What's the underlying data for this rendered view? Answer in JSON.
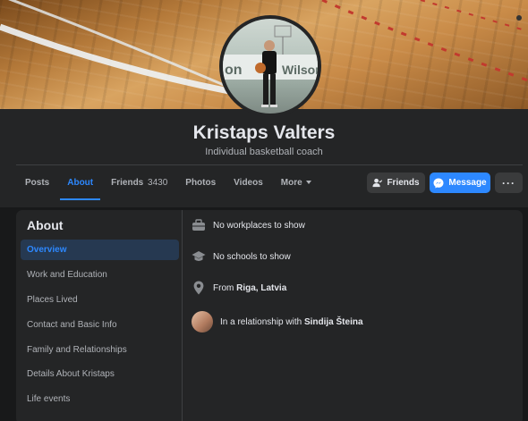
{
  "profile": {
    "name": "Kristaps Valters",
    "bio": "Individual basketball coach"
  },
  "cover": {
    "banner_text_left": "on",
    "banner_text_right": "Wilson"
  },
  "tabs": [
    {
      "label": "Posts",
      "active": false
    },
    {
      "label": "About",
      "active": true
    },
    {
      "label": "Friends",
      "count": "3430",
      "active": false
    },
    {
      "label": "Photos",
      "active": false
    },
    {
      "label": "Videos",
      "active": false
    },
    {
      "label": "More",
      "active": false
    }
  ],
  "actions": {
    "friends_label": "Friends",
    "message_label": "Message",
    "more_label": "···"
  },
  "about": {
    "title": "About",
    "menu": [
      {
        "label": "Overview",
        "active": true
      },
      {
        "label": "Work and Education",
        "active": false
      },
      {
        "label": "Places Lived",
        "active": false
      },
      {
        "label": "Contact and Basic Info",
        "active": false
      },
      {
        "label": "Family and Relationships",
        "active": false
      },
      {
        "label": "Details About Kristaps",
        "active": false
      },
      {
        "label": "Life events",
        "active": false
      }
    ],
    "overview": {
      "work": "No workplaces to show",
      "school": "No schools to show",
      "from_prefix": "From",
      "from_place": "Riga, Latvia",
      "relationship_prefix": "In a relationship with",
      "relationship_partner": "Sindija Šteina"
    }
  },
  "colors": {
    "accent": "#2d88ff",
    "background": "#18191a",
    "card": "#242526"
  }
}
